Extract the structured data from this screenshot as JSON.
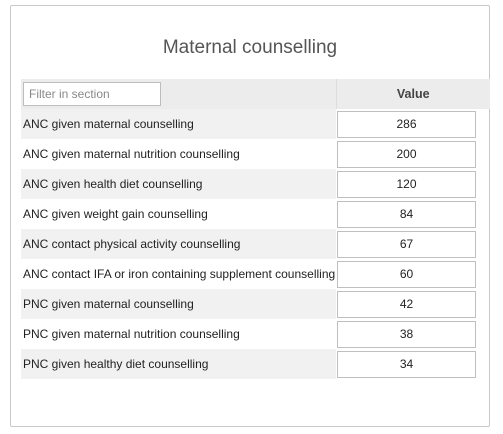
{
  "section": {
    "title": "Maternal counselling",
    "filter_placeholder": "Filter in section",
    "filter_value": "",
    "value_header": "Value"
  },
  "rows": [
    {
      "label": "ANC given maternal counselling",
      "value": "286"
    },
    {
      "label": "ANC given maternal nutrition counselling",
      "value": "200"
    },
    {
      "label": "ANC given health diet counselling",
      "value": "120"
    },
    {
      "label": "ANC given weight gain counselling",
      "value": "84"
    },
    {
      "label": "ANC contact physical activity counselling",
      "value": "67"
    },
    {
      "label": "ANC contact IFA or iron containing supplement counselling",
      "value": "60"
    },
    {
      "label": "PNC given maternal counselling",
      "value": "42"
    },
    {
      "label": "PNC given maternal nutrition counselling",
      "value": "38"
    },
    {
      "label": "PNC given healthy diet counselling",
      "value": "34"
    }
  ]
}
